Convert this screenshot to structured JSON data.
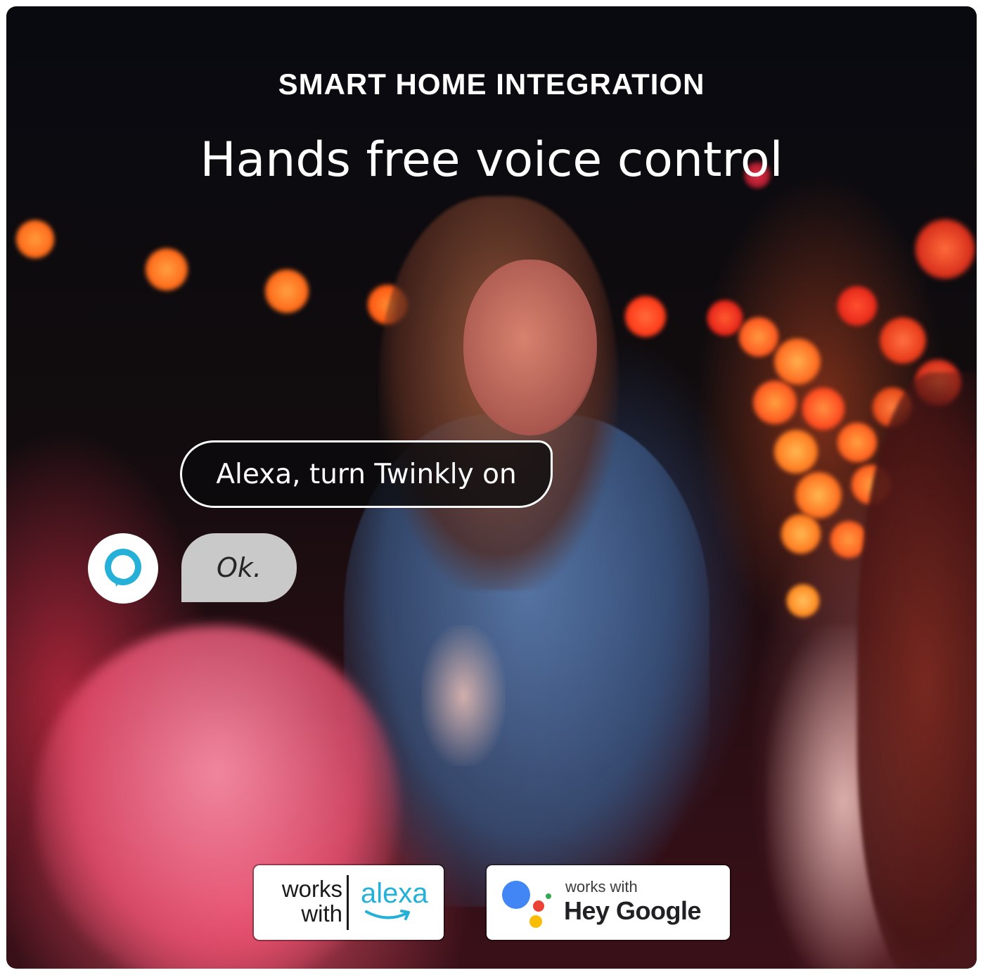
{
  "header": {
    "eyebrow": "SMART HOME INTEGRATION",
    "headline": "Hands free voice control"
  },
  "conversation": {
    "user_message": "Alexa, turn Twinkly on",
    "assistant_reply": "Ok.",
    "assistant_icon": "alexa-ring-icon"
  },
  "badges": {
    "alexa": {
      "works_with": "works with",
      "brand": "alexa",
      "brand_color": "#25b0d8"
    },
    "google": {
      "works_with": "works with",
      "brand": "Hey Google",
      "dot_colors": [
        "#4285f4",
        "#ea4335",
        "#fbbc05",
        "#34a853"
      ]
    }
  },
  "colors": {
    "reply_bubble": "#c9c9c9",
    "user_bubble_border": "#ffffff"
  }
}
